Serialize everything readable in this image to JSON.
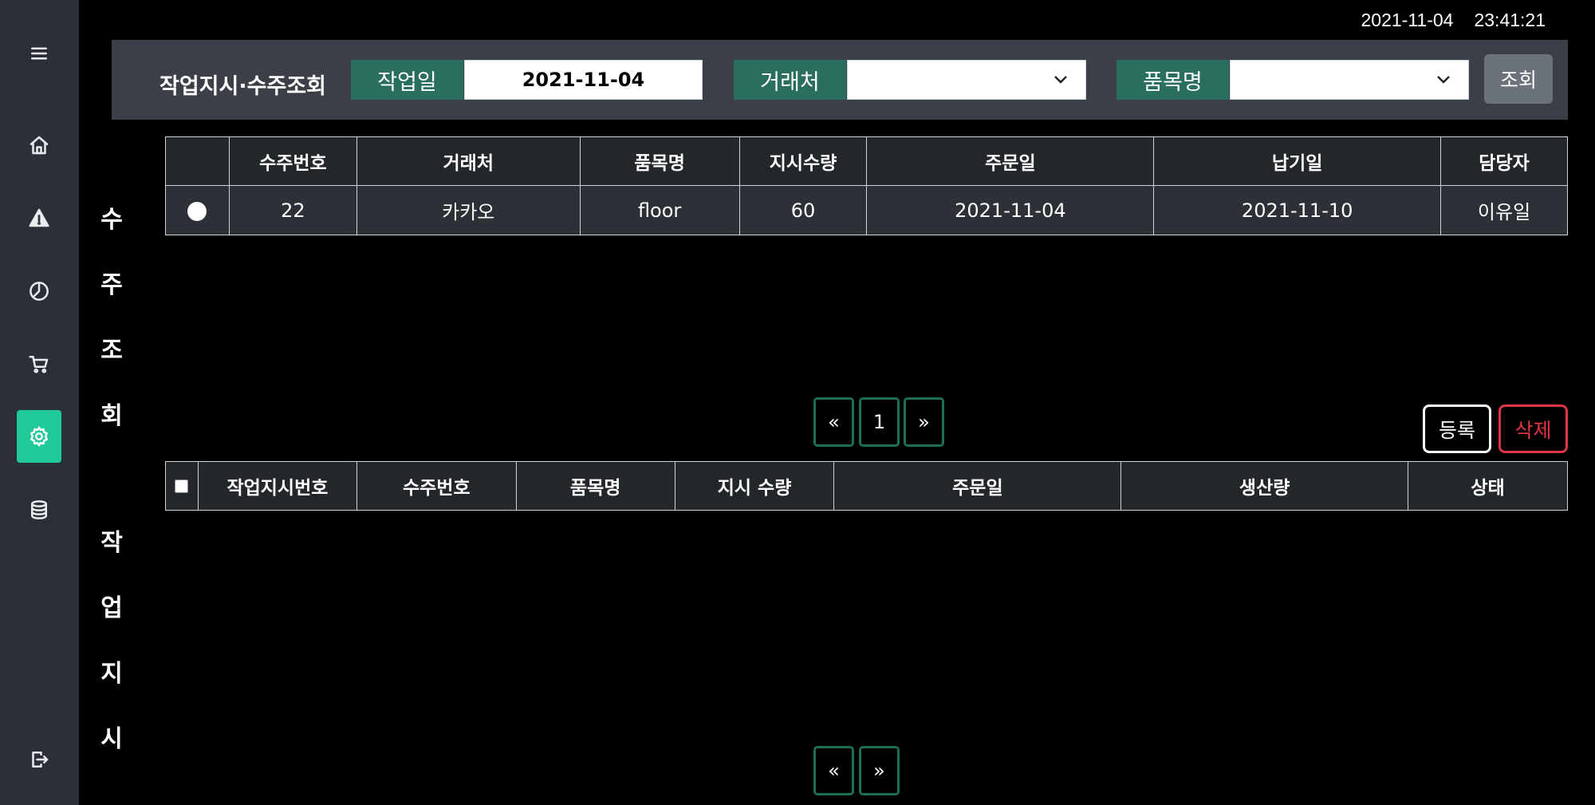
{
  "clock": {
    "date": "2021-11-04",
    "time": "23:41:21"
  },
  "sidebar": {
    "items": [
      {
        "icon": "menu-icon"
      },
      {
        "icon": "home-icon"
      },
      {
        "icon": "warning-icon"
      },
      {
        "icon": "pie-chart-icon"
      },
      {
        "icon": "cart-icon"
      },
      {
        "icon": "gear-icon",
        "active": true
      },
      {
        "icon": "database-icon"
      },
      {
        "icon": "logout-icon"
      }
    ]
  },
  "header": {
    "title": "작업지시·수주조회",
    "work_date_label": "작업일",
    "work_date_value": "2021-11-04",
    "client_label": "거래처",
    "client_value": "",
    "item_label": "품목명",
    "item_value": "",
    "search_label": "조회"
  },
  "sections": {
    "orders_vertical": [
      "수",
      "주",
      "조",
      "회"
    ],
    "work_vertical": [
      "작",
      "업",
      "지",
      "시"
    ]
  },
  "orders_table": {
    "columns": [
      "",
      "수주번호",
      "거래처",
      "품목명",
      "지시수량",
      "주문일",
      "납기일",
      "담당자"
    ],
    "rows": [
      {
        "order_no": "22",
        "client": "카카오",
        "item": "floor",
        "qty": "60",
        "order_date": "2021-11-04",
        "due_date": "2021-11-10",
        "manager": "이유일"
      }
    ]
  },
  "orders_pagination": {
    "prev": "«",
    "page": "1",
    "next": "»"
  },
  "actions": {
    "register": "등록",
    "delete": "삭제"
  },
  "work_table": {
    "columns": [
      "",
      "작업지시번호",
      "수주번호",
      "품목명",
      "지시 수량",
      "주문일",
      "생산량",
      "상태"
    ],
    "rows": []
  },
  "work_pagination": {
    "prev": "«",
    "next": "»"
  },
  "colors": {
    "accent": "#20c997",
    "label_bg": "#2a6f5e",
    "delete": "#dc3545",
    "sidebar": "#2b3038"
  }
}
